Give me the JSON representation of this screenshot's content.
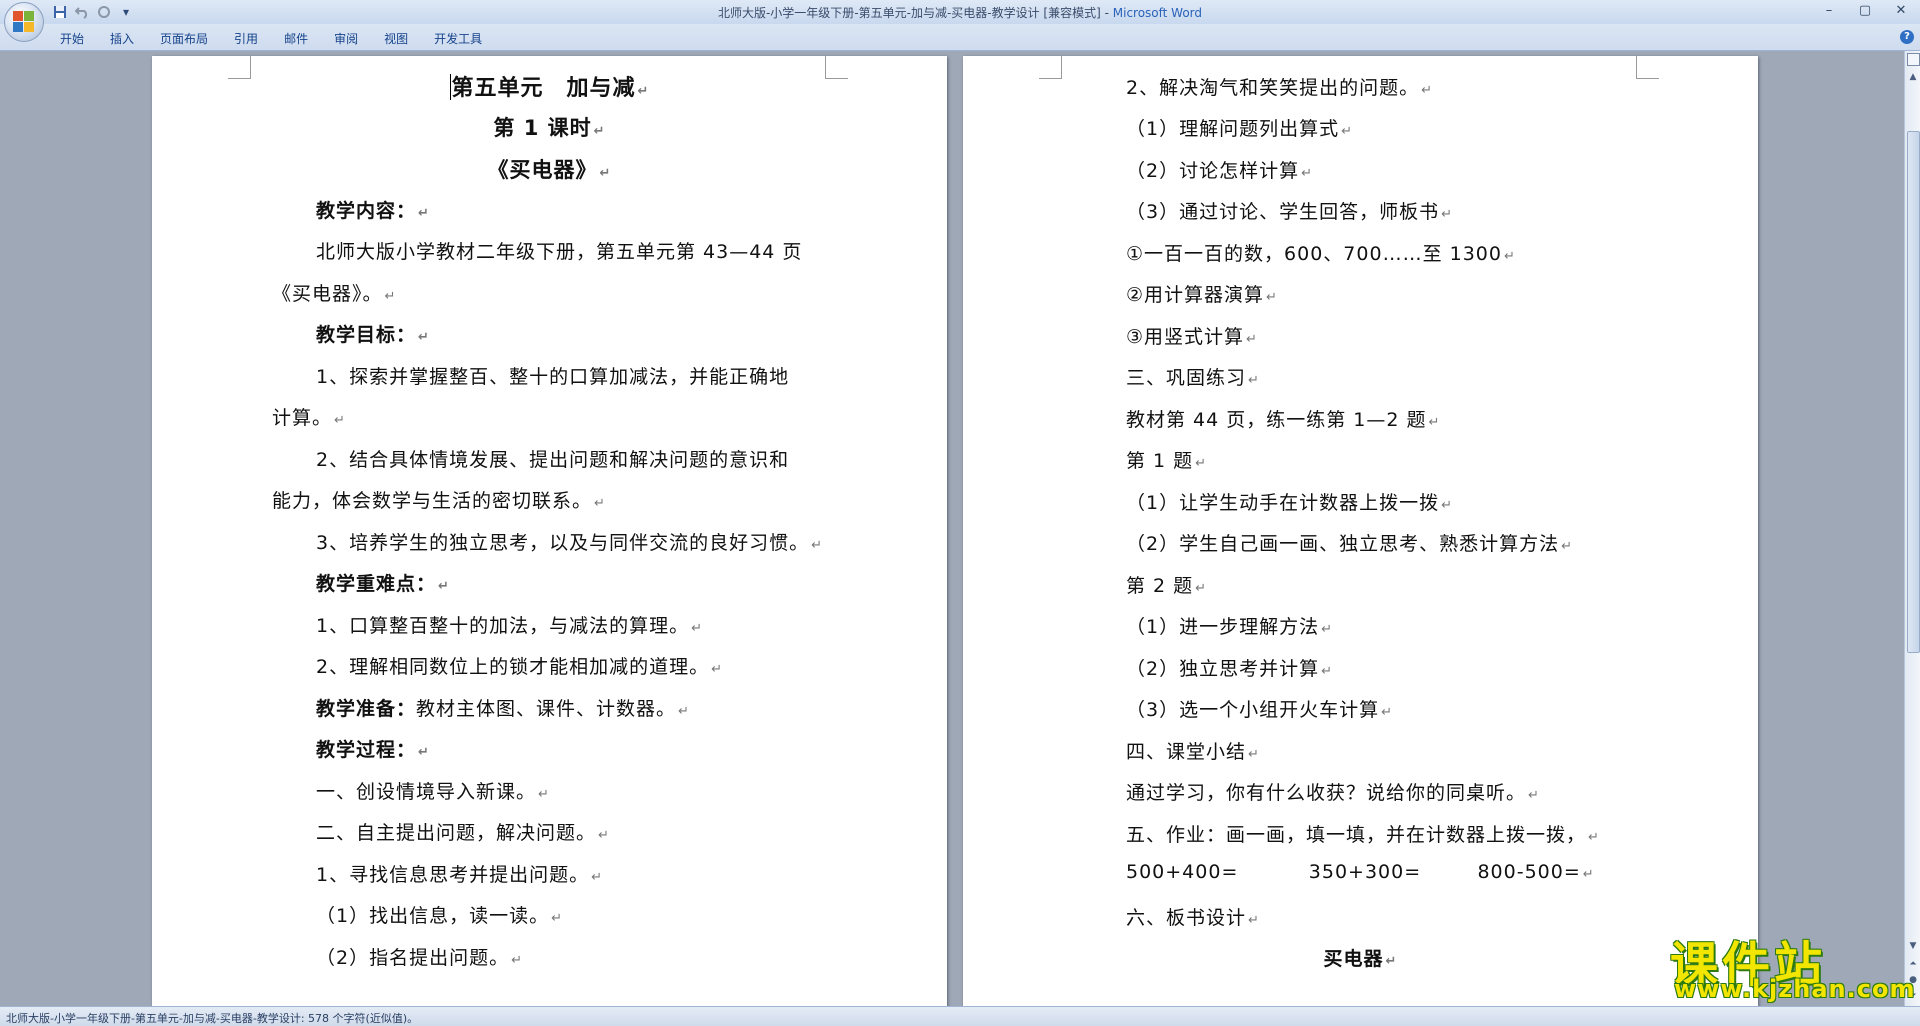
{
  "window": {
    "title": "北师大版-小学一年级下册-第五单元-加与减-买电器-教学设计 [兼容模式] - ",
    "app_name": "Microsoft Word",
    "controls": [
      "–",
      "▢",
      "✕"
    ]
  },
  "qat": {
    "save": "save-icon",
    "undo": "undo-icon",
    "redo": "redo-icon",
    "more": "▾"
  },
  "ribbon": {
    "tabs": [
      "开始",
      "插入",
      "页面布局",
      "引用",
      "邮件",
      "审阅",
      "视图",
      "开发工具"
    ],
    "help": "?"
  },
  "left_page": {
    "title": "第五单元　加与减",
    "lesson": "第 1 课时",
    "topic": "《买电器》",
    "lines": [
      "教学内容：",
      "北师大版小学教材二年级下册，第五单元第  43—44  页",
      "《买电器》。",
      "教学目标：",
      "1、探索并掌握整百、整十的口算加减法，并能正确地",
      "计算。",
      "2、结合具体情境发展、提出问题和解决问题的意识和",
      "能力，体会数学与生活的密切联系。",
      "3、培养学生的独立思考，以及与同伴交流的良好习惯。",
      "教学重难点：",
      "1、口算整百整十的加法，与减法的算理。",
      "2、理解相同数位上的锁才能相加减的道理。",
      "教学准备：",
      "教学过程：",
      "一、创设情境导入新课。",
      "二、自主提出问题，解决问题。",
      "1、寻找信息思考并提出问题。",
      "（1）找出信息，读一读。",
      "（2）指名提出问题。"
    ],
    "prep_text": "教材主体图、课件、计数器。"
  },
  "right_page": {
    "lines": [
      "2、解决淘气和笑笑提出的问题。",
      "（1）理解问题列出算式",
      "（2）讨论怎样计算",
      "（3）通过讨论、学生回答，师板书",
      "①一百一百的数，600、700……至 1300",
      "②用计算器演算",
      "③用竖式计算",
      "三、巩固练习",
      "教材第 44 页，练一练第 1—2 题",
      "第 1 题",
      "（1）让学生动手在计数器上拨一拨",
      "（2）学生自己画一画、独立思考、熟悉计算方法",
      "第 2 题",
      "（1）进一步理解方法",
      "（2）独立思考并计算",
      "（3）选一个小组开火车计算",
      "四、课堂小结",
      "通过学习，你有什么收获？说给你的同桌听。",
      "五、作业：画一画，填一填，并在计数器上拨一拨，",
      "500+400=          350+300=        800-500=",
      "六、板书设计"
    ],
    "board_title": "买电器"
  },
  "status": {
    "text": "北师大版-小学一年级下册-第五单元-加与减-买电器-教学设计: 578 个字符(近似值)。"
  },
  "watermark": {
    "main": "课件站",
    "url": "www.kjzhan.com"
  },
  "paragraph_mark": "↵",
  "colors": {
    "page_bg": "#ffffff",
    "doc_bg": "#9fa8b6",
    "ribbon_text": "#15428b",
    "watermark": "#f2e600"
  }
}
